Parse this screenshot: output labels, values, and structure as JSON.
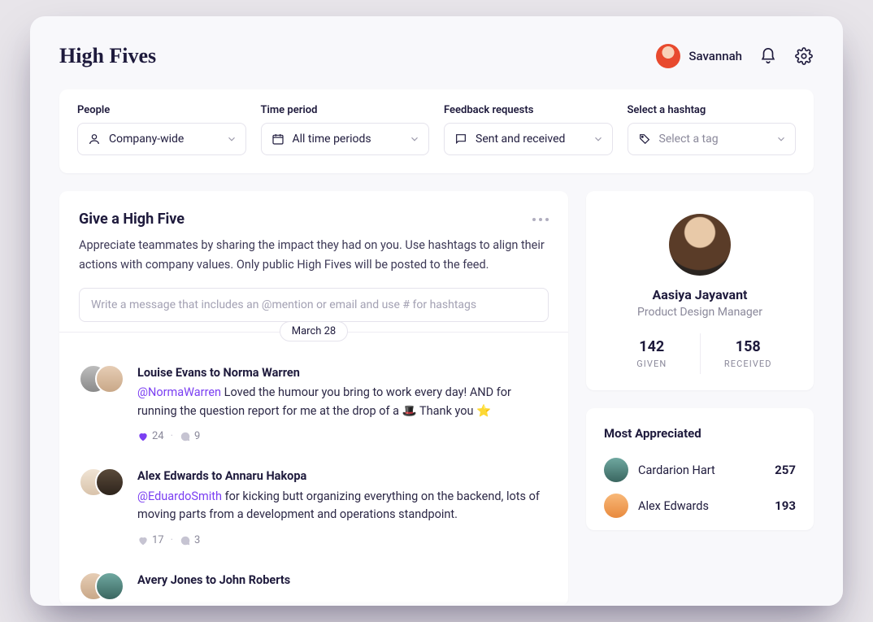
{
  "header": {
    "title": "High Fives",
    "user_name": "Savannah"
  },
  "filters": {
    "people": {
      "label": "People",
      "value": "Company-wide"
    },
    "period": {
      "label": "Time period",
      "value": "All time periods"
    },
    "feedback": {
      "label": "Feedback requests",
      "value": "Sent and received"
    },
    "hashtag": {
      "label": "Select a hashtag",
      "value": "Select a tag",
      "is_placeholder": true
    }
  },
  "compose": {
    "title": "Give a High Five",
    "description": "Appreciate teammates by sharing the impact they had on you. Use hashtags to align their actions with company values. Only public High Fives will be posted to the feed.",
    "placeholder": "Write a message that includes an @mention or email and use # for hashtags"
  },
  "feed": {
    "date_separator": "March 28",
    "posts": [
      {
        "header": "Louise Evans to Norma Warren",
        "mention": "@NormaWarren",
        "text": " Loved the humour you bring to work every day! AND for running the question report for me at the drop of a 🎩 Thank you ⭐",
        "likes": 24,
        "comments": 9,
        "liked": true
      },
      {
        "header": "Alex Edwards to Annaru Hakopa",
        "mention": "@EduardoSmith",
        "text": " for kicking butt organizing everything on the backend, lots of moving parts from a development and operations standpoint.",
        "likes": 17,
        "comments": 3,
        "liked": false
      },
      {
        "header": "Avery Jones to John Roberts",
        "mention": "",
        "text": "",
        "likes": null,
        "comments": null,
        "liked": false
      }
    ]
  },
  "profile": {
    "name": "Aasiya Jayavant",
    "role": "Product Design Manager",
    "given": 142,
    "given_label": "GIVEN",
    "received": 158,
    "received_label": "RECEIVED"
  },
  "most_appreciated": {
    "title": "Most Appreciated",
    "rows": [
      {
        "name": "Cardarion Hart",
        "count": 257
      },
      {
        "name": "Alex Edwards",
        "count": 193
      }
    ]
  }
}
